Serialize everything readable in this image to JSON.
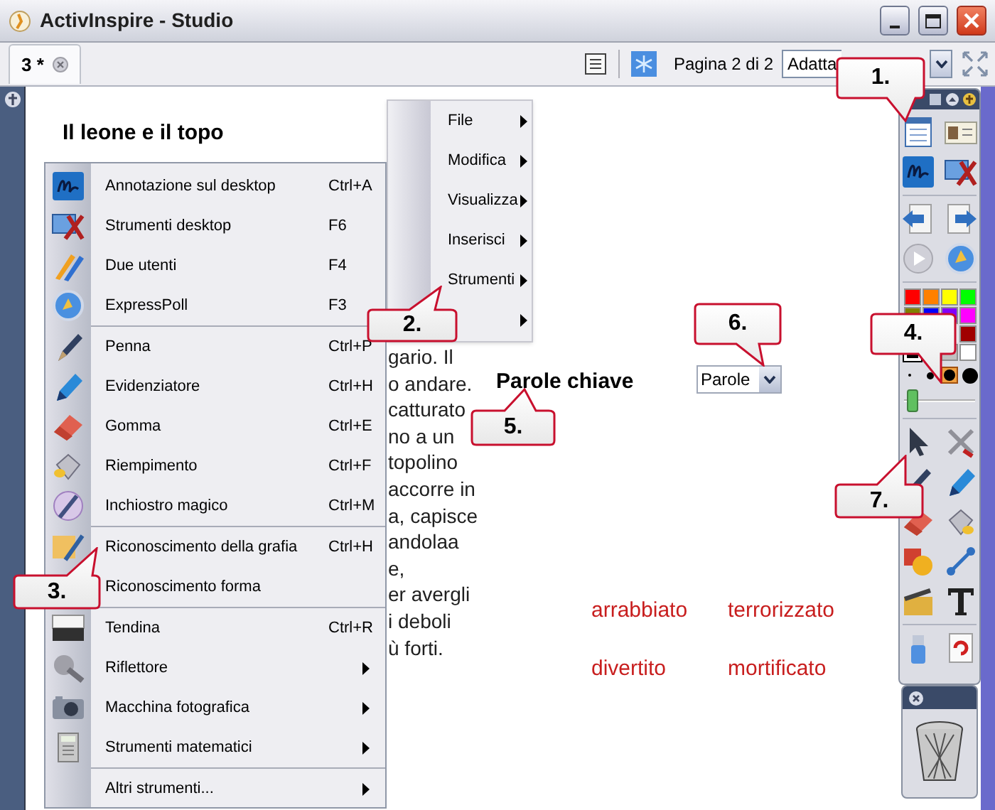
{
  "window": {
    "title": "ActivInspire - Studio"
  },
  "tabs": [
    {
      "label": "3 *",
      "selected": true
    }
  ],
  "page_indicator": "Pagina 2 di 2",
  "zoom_select": {
    "value": "Adatta"
  },
  "flipchart": {
    "title": "Il leone e il topo",
    "story_lines": [
      "gario. Il",
      "o andare.",
      "catturato",
      "no a un",
      "topolino",
      "accorre in",
      "a, capisce",
      "andolaa",
      "e,",
      "er avergli",
      "i deboli",
      "ù forti."
    ],
    "keywords_heading": "Parole chiave",
    "dropdown": {
      "value": "Parole"
    },
    "words": [
      {
        "text": "arrabbiato"
      },
      {
        "text": "terrorizzato"
      },
      {
        "text": "divertito"
      },
      {
        "text": "mortificato"
      }
    ]
  },
  "parent_menu": {
    "items": [
      {
        "label": "File",
        "has_submenu": true
      },
      {
        "label": "Modifica",
        "has_submenu": true
      },
      {
        "label": "Visualizza",
        "has_submenu": true
      },
      {
        "label": "Inserisci",
        "has_submenu": true
      },
      {
        "label": "Strumenti",
        "has_submenu": true
      },
      {
        "has_submenu": true
      }
    ]
  },
  "context_menu": {
    "sections": [
      [
        {
          "label": "Annotazione sul desktop",
          "shortcut": "Ctrl+A",
          "has_submenu": false
        },
        {
          "label": "Strumenti desktop",
          "shortcut": "F6",
          "has_submenu": false
        },
        {
          "label": "Due utenti",
          "shortcut": "F4",
          "has_submenu": false
        },
        {
          "label": "ExpressPoll",
          "shortcut": "F3",
          "has_submenu": false
        }
      ],
      [
        {
          "label": "Penna",
          "shortcut": "Ctrl+P",
          "has_submenu": false
        },
        {
          "label": "Evidenziatore",
          "shortcut": "Ctrl+H",
          "has_submenu": false
        },
        {
          "label": "Gomma",
          "shortcut": "Ctrl+E",
          "has_submenu": false
        },
        {
          "label": "Riempimento",
          "shortcut": "Ctrl+F",
          "has_submenu": false
        },
        {
          "label": "Inchiostro magico",
          "shortcut": "Ctrl+M",
          "has_submenu": false
        }
      ],
      [
        {
          "label": "Riconoscimento della grafia",
          "shortcut": "Ctrl+H",
          "has_submenu": false
        },
        {
          "label": "Riconoscimento forma",
          "has_submenu": false
        }
      ],
      [
        {
          "label": "Tendina",
          "shortcut": "Ctrl+R",
          "has_submenu": false
        },
        {
          "label": "Riflettore",
          "has_submenu": true
        },
        {
          "label": "Macchina fotografica",
          "has_submenu": true
        },
        {
          "label": "Strumenti matematici",
          "has_submenu": true
        }
      ],
      [
        {
          "label": "Altri strumenti...",
          "has_submenu": true
        }
      ]
    ]
  },
  "palette": [
    {
      "kind": "swatch",
      "color": "#ff0000",
      "selected": false
    },
    {
      "kind": "swatch",
      "color": "#ff8000",
      "selected": false
    },
    {
      "kind": "swatch",
      "color": "#ffff00",
      "selected": false
    },
    {
      "kind": "swatch",
      "color": "#00ff00",
      "selected": false
    },
    {
      "kind": "swatch",
      "color": "#808000",
      "selected": false
    },
    {
      "kind": "swatch",
      "color": "#0000ff",
      "selected": false
    },
    {
      "kind": "swatch",
      "color": "#8000ff",
      "selected": false
    },
    {
      "kind": "swatch",
      "color": "#ff00ff",
      "selected": false
    },
    {
      "kind": "covered"
    },
    {
      "kind": "covered"
    },
    {
      "kind": "covered"
    },
    {
      "kind": "swatch",
      "color": "#a00000",
      "selected": false
    },
    {
      "kind": "swatch",
      "color": "#000000",
      "selected": true
    },
    {
      "kind": "covered"
    },
    {
      "kind": "swatch",
      "color": "#c0c0c0",
      "selected": false
    },
    {
      "kind": "swatch",
      "color": "#ffffff",
      "selected": false
    }
  ],
  "pen_widths": [
    {
      "selected": false
    },
    {
      "selected": false
    },
    {
      "selected": true
    },
    {
      "selected": false
    }
  ],
  "width_slider": {
    "level": 0.05
  },
  "callouts": [
    {
      "label": "1."
    },
    {
      "label": "2."
    },
    {
      "label": "3."
    },
    {
      "label": "4."
    },
    {
      "label": "5."
    },
    {
      "label": "6."
    },
    {
      "label": "7."
    }
  ]
}
